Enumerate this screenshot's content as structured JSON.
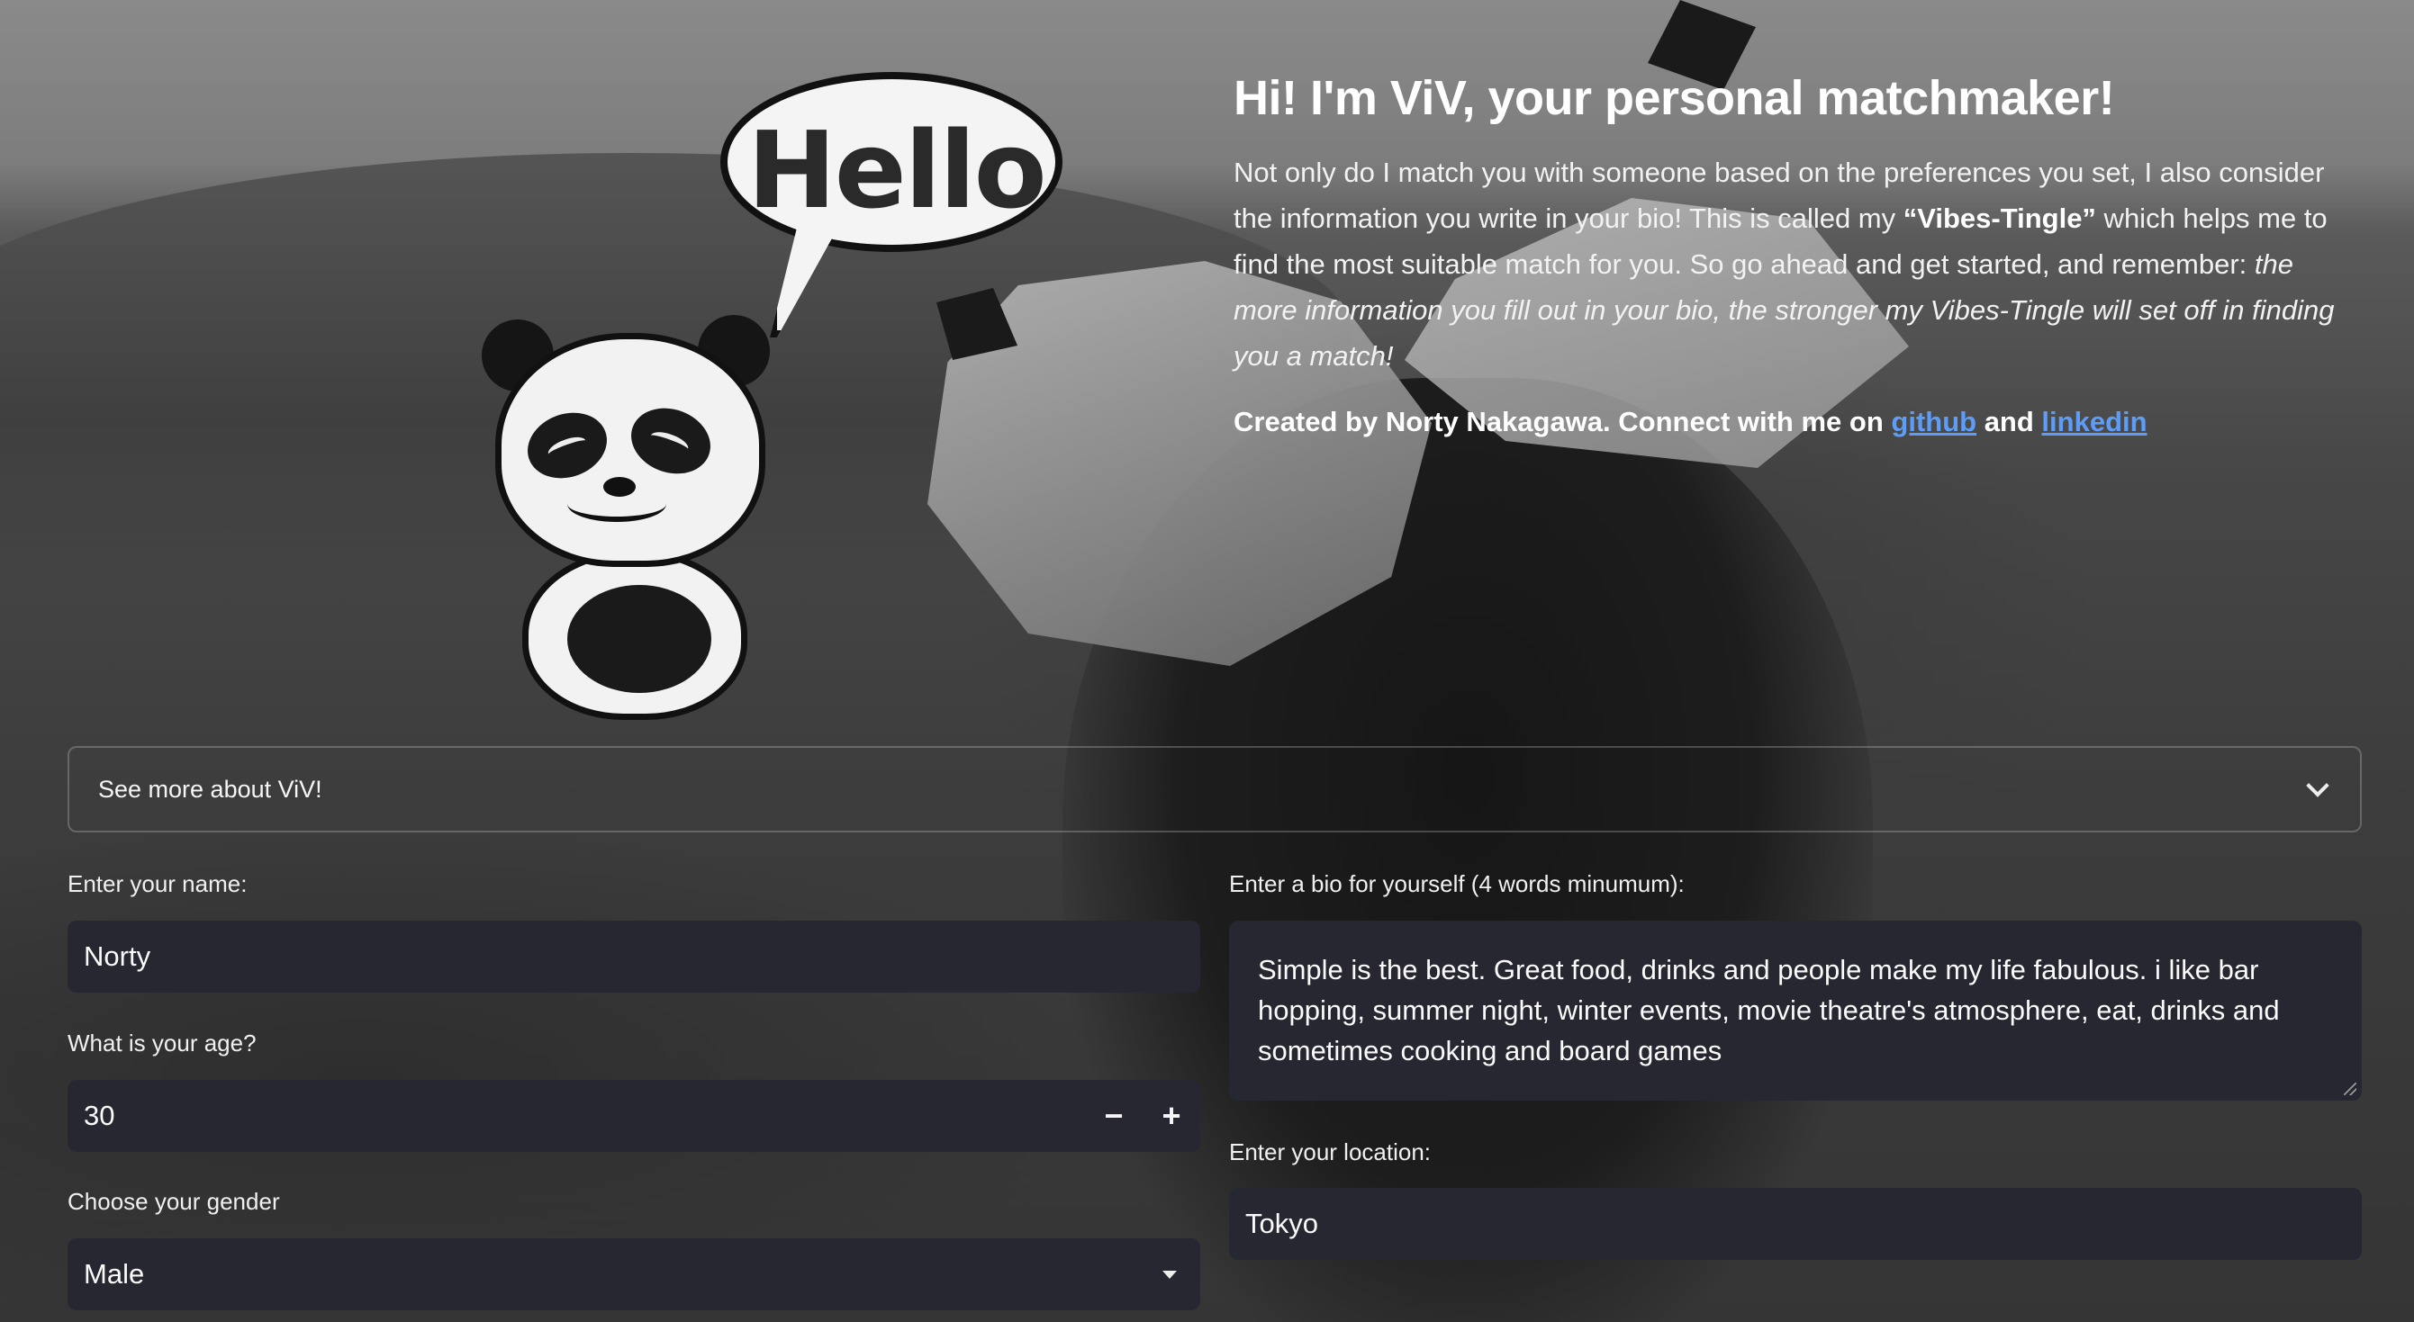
{
  "intro": {
    "title": "Hi! I'm ViV, your personal matchmaker!",
    "para_part1": "Not only do I match you with someone based on the preferences you set, I also consider the information you write in your bio! This is called my ",
    "para_bold": "“Vibes-Tingle”",
    "para_part2": " which helps me to find the most suitable match for you. So go ahead and get started, and remember: ",
    "para_italic": "the more information you fill out in your bio, the stronger my Vibes-Tingle will set off in finding you a match!",
    "credit_prefix": "Created by Norty Nakagawa. Connect with me on ",
    "credit_github": "github",
    "credit_and": " and ",
    "credit_linkedin": "linkedin"
  },
  "illustration": {
    "speech_text": "Hello"
  },
  "expander": {
    "label": "See more about ViV!"
  },
  "form": {
    "name_label": "Enter your name:",
    "name_value": "Norty",
    "age_label": "What is your age?",
    "age_value": "30",
    "decrement": "−",
    "increment": "+",
    "gender_label": "Choose your gender",
    "gender_value": "Male",
    "bio_label": "Enter a bio for yourself (4 words minumum):",
    "bio_value": "Simple is the best. Great food, drinks and people make my life fabulous. i like bar hopping, summer night, winter events, movie theatre's atmosphere, eat, drinks and sometimes cooking and board games",
    "location_label": "Enter your location:",
    "location_value": "Tokyo"
  },
  "colors": {
    "input_bg": "#262730",
    "link": "#5d9cf7"
  }
}
